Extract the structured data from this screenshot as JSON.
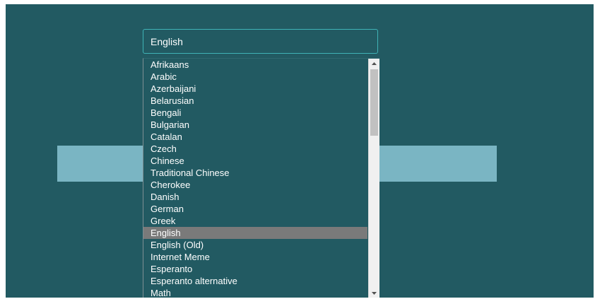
{
  "language_select": {
    "selected_value": "English",
    "options": [
      "Afrikaans",
      "Arabic",
      "Azerbaijani",
      "Belarusian",
      "Bengali",
      "Bulgarian",
      "Catalan",
      "Czech",
      "Chinese",
      "Traditional Chinese",
      "Cherokee",
      "Danish",
      "German",
      "Greek",
      "English",
      "English (Old)",
      "Internet Meme",
      "Esperanto",
      "Esperanto alternative",
      "Math"
    ],
    "selected_index": 14
  },
  "colors": {
    "background": "#225a62",
    "accent_bar": "#7ab5c3",
    "select_border": "#3fb3b6",
    "highlight": "#7a7a7a"
  },
  "icons": {
    "scroll_up": "scroll-up-arrow-icon",
    "scroll_down": "scroll-down-arrow-icon"
  }
}
